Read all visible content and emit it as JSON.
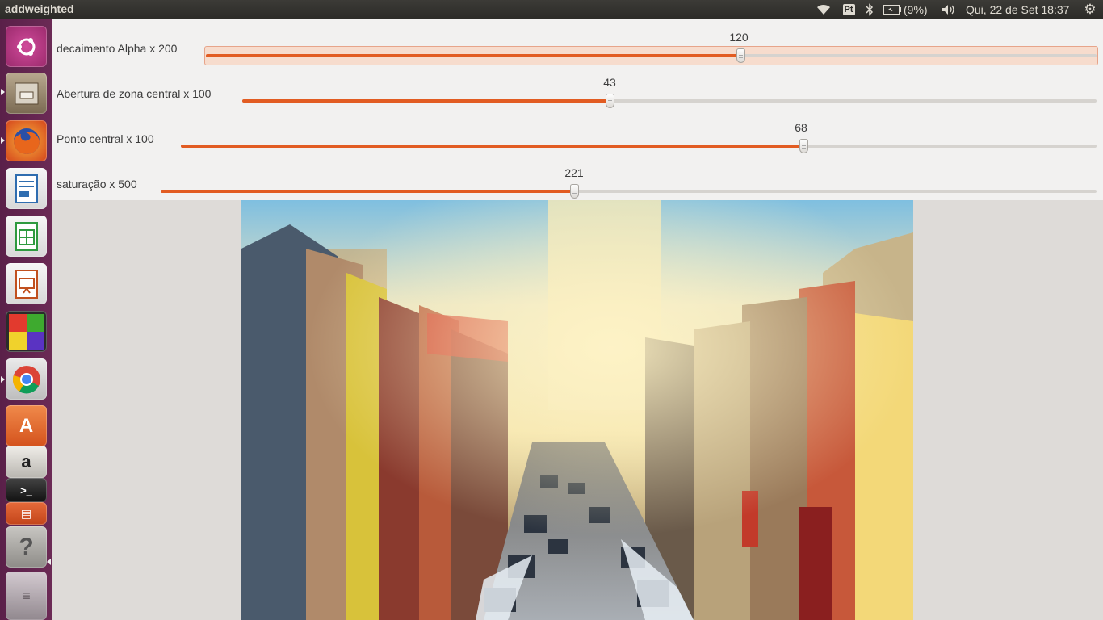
{
  "topbar": {
    "app_title": "addweighted",
    "keyboard_layout": "Pt",
    "battery": "(9%)",
    "clock": "Qui, 22 de Set 18:37"
  },
  "launcher": {
    "items": [
      {
        "name": "dash-home",
        "bg": "#b2357e"
      },
      {
        "name": "files",
        "bg": "#8a7a62"
      },
      {
        "name": "firefox",
        "bg": "#c7522a"
      },
      {
        "name": "libreoffice-writer",
        "bg": "#2f6db0"
      },
      {
        "name": "libreoffice-calc",
        "bg": "#2e9a3f"
      },
      {
        "name": "libreoffice-impress",
        "bg": "#c1501f"
      },
      {
        "name": "workspaces",
        "bg": "#3a3a3a"
      },
      {
        "name": "chrome",
        "bg": "#d8d8d8"
      },
      {
        "name": "software-center",
        "bg": "#e0622a"
      },
      {
        "name": "amazon",
        "bg": "#c9c6c0"
      },
      {
        "name": "help",
        "bg": "#9a9894"
      }
    ]
  },
  "sliders": [
    {
      "label": "decaimento Alpha x 200",
      "value": "120",
      "fraction": 0.6
    },
    {
      "label": "Abertura de zona central x 100",
      "value": "43",
      "fraction": 0.43
    },
    {
      "label": "Ponto central x 100",
      "value": "68",
      "fraction": 0.68
    },
    {
      "label": "saturação x 500",
      "value": "221",
      "fraction": 0.442
    }
  ],
  "colors": {
    "accent": "#e25c22",
    "panel_bg": "#f2f1f0",
    "launcher_bg": "#5f2350"
  }
}
